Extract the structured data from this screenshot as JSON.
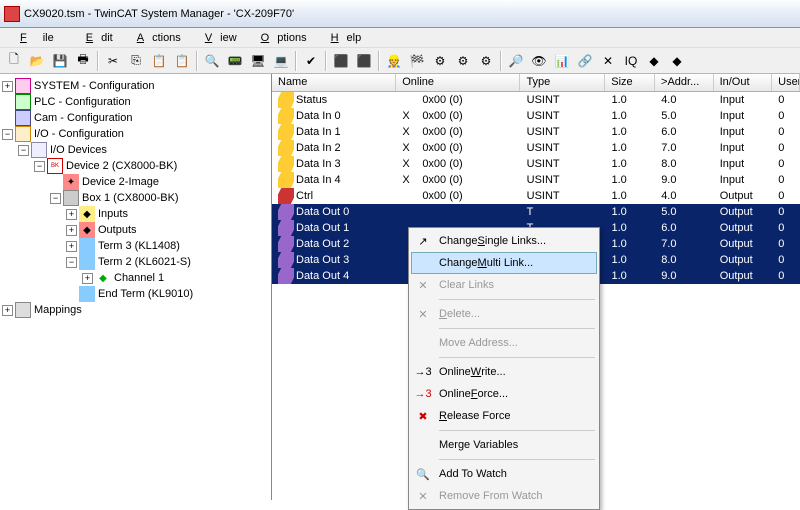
{
  "window": {
    "title": "CX9020.tsm - TwinCAT System Manager - 'CX-209F70'"
  },
  "menu": {
    "file": "File",
    "edit": "Edit",
    "actions": "Actions",
    "view": "View",
    "options": "Options",
    "help": "Help"
  },
  "tree": {
    "n0": "SYSTEM - Configuration",
    "n1": "PLC - Configuration",
    "n2": "Cam - Configuration",
    "n3": "I/O - Configuration",
    "n4": "I/O Devices",
    "n5": "Device 2 (CX8000-BK)",
    "n6": "Device 2-Image",
    "n7": "Box 1 (CX8000-BK)",
    "n8": "Inputs",
    "n9": "Outputs",
    "n10": "Term 3 (KL1408)",
    "n11": "Term 2 (KL6021-S)",
    "n12": "Channel 1",
    "n13": "End Term (KL9010)",
    "n14": "Mappings"
  },
  "cols": {
    "name": "Name",
    "online": "Online",
    "type": "Type",
    "size": "Size",
    "addr": ">Addr...",
    "inout": "In/Out",
    "user": "User"
  },
  "rows": [
    {
      "name": "Status",
      "x": "",
      "online": "0x00 (0)",
      "type": "USINT",
      "size": "1.0",
      "addr": "4.0",
      "inout": "Input",
      "user": "0",
      "ic": "vi-y"
    },
    {
      "name": "Data In 0",
      "x": "X",
      "online": "0x00 (0)",
      "type": "USINT",
      "size": "1.0",
      "addr": "5.0",
      "inout": "Input",
      "user": "0",
      "ic": "vi-y"
    },
    {
      "name": "Data In 1",
      "x": "X",
      "online": "0x00 (0)",
      "type": "USINT",
      "size": "1.0",
      "addr": "6.0",
      "inout": "Input",
      "user": "0",
      "ic": "vi-y"
    },
    {
      "name": "Data In 2",
      "x": "X",
      "online": "0x00 (0)",
      "type": "USINT",
      "size": "1.0",
      "addr": "7.0",
      "inout": "Input",
      "user": "0",
      "ic": "vi-y"
    },
    {
      "name": "Data In 3",
      "x": "X",
      "online": "0x00 (0)",
      "type": "USINT",
      "size": "1.0",
      "addr": "8.0",
      "inout": "Input",
      "user": "0",
      "ic": "vi-y"
    },
    {
      "name": "Data In 4",
      "x": "X",
      "online": "0x00 (0)",
      "type": "USINT",
      "size": "1.0",
      "addr": "9.0",
      "inout": "Input",
      "user": "0",
      "ic": "vi-y"
    },
    {
      "name": "Ctrl",
      "x": "",
      "online": "0x00 (0)",
      "type": "USINT",
      "size": "1.0",
      "addr": "4.0",
      "inout": "Output",
      "user": "0",
      "ic": "vi-r"
    },
    {
      "name": "Data Out 0",
      "x": "",
      "online": "",
      "type": "T",
      "size": "1.0",
      "addr": "5.0",
      "inout": "Output",
      "user": "0",
      "ic": "vi-p",
      "sel": true
    },
    {
      "name": "Data Out 1",
      "x": "",
      "online": "",
      "type": "T",
      "size": "1.0",
      "addr": "6.0",
      "inout": "Output",
      "user": "0",
      "ic": "vi-p",
      "sel": true
    },
    {
      "name": "Data Out 2",
      "x": "",
      "online": "",
      "type": "T",
      "size": "1.0",
      "addr": "7.0",
      "inout": "Output",
      "user": "0",
      "ic": "vi-p",
      "sel": true
    },
    {
      "name": "Data Out 3",
      "x": "",
      "online": "",
      "type": "T",
      "size": "1.0",
      "addr": "8.0",
      "inout": "Output",
      "user": "0",
      "ic": "vi-p",
      "sel": true
    },
    {
      "name": "Data Out 4",
      "x": "",
      "online": "",
      "type": "T",
      "size": "1.0",
      "addr": "9.0",
      "inout": "Output",
      "user": "0",
      "ic": "vi-p",
      "sel": true
    }
  ],
  "ctx": {
    "changeSingle": "Change Single Links...",
    "changeMulti": "Change Multi Link...",
    "clearLinks": "Clear Links",
    "delete": "Delete...",
    "moveAddr": "Move Address...",
    "onlineWrite": "Online Write...",
    "onlineForce": "Online Force...",
    "releaseForce": "Release Force",
    "mergeVars": "Merge Variables",
    "addWatch": "Add To Watch",
    "removeWatch": "Remove From Watch"
  }
}
